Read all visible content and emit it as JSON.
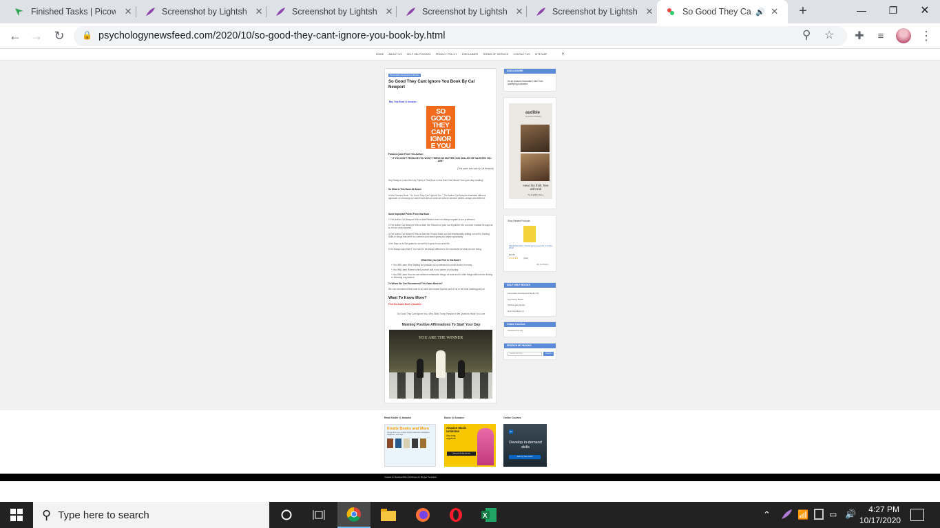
{
  "browser": {
    "tabs": [
      {
        "title": "Finished Tasks | Picowo",
        "icon": "picoworkers-arrow-icon",
        "active": false
      },
      {
        "title": "Screenshot by Lightshot",
        "icon": "lightshot-feather-icon",
        "active": false
      },
      {
        "title": "Screenshot by Lightshot",
        "icon": "lightshot-feather-icon",
        "active": false
      },
      {
        "title": "Screenshot by Lightshot",
        "icon": "lightshot-feather-icon",
        "active": false
      },
      {
        "title": "Screenshot by Lightshot",
        "icon": "lightshot-feather-icon",
        "active": false
      },
      {
        "title": "So Good They Cant",
        "icon": "site-favicon-icon",
        "active": true
      }
    ],
    "url": "psychologynewsfeed.com/2020/10/so-good-they-cant-ignore-you-book-by.html"
  },
  "site": {
    "nav": [
      "HOME",
      "ABOUT US",
      "SELF HELP BOOKS",
      "PRIVACY POLICY",
      "DISCLAIMER",
      "TERMS OF SERVICE",
      "CONTACT US",
      "SITE MAP"
    ],
    "post": {
      "category": "Personality Development Books",
      "title": "So Good They Cant Ignore You Book By Cal Newport",
      "buy_link": "Buy This Book @ Amazon :",
      "book_cover_text": "SO GOOD THEY CAN'T IGNORE YOU",
      "book_author": "CAL NEWPORT",
      "quote_heading": "Famous Quote From This Author :",
      "quote": "\" IF YOU DON'T PRODUCE YOU WON'T THRIVE-NO MATTER HOW SKILLED OR TALENTED YOU ARE.\"",
      "quote_attr": "(This quote was said by Cal Newport)",
      "intro": "Hey Ready to Learn the Key Points of This Book in less than One Minute? then just keep reading!",
      "about_heading": "So What Is This Book All About :",
      "about_text": "In this Famous Book \" So Good They Can't Ignore You \", The Author Cal Newport Illustrates different approach on choosing our career and tells us what we need to become skilled, unique and different.",
      "points_heading": "Some Important Points From this Book :",
      "points": [
        "1.The Author Cal Newport Tells us that Passion does not always equate to our profession.",
        "2.The Author Cal Newport Tells us that, We Should not pour our impulsive into our work, Instead he says us to, let our work impress.",
        "3.The Author Cal Newport Tells us that We Should Make our self irreplaceably skilling our self in Gaining Skills in things that aren't so common and which gives you ample opportunity.",
        "4.He Says us to Set goals for our self is to grow in our work life.",
        "5.He Always says that if, You have to be always different to be successful at what you are doing."
      ],
      "learn_heading": "What Else you Can Find in this Book?",
      "learn_items": [
        "+ You Will Learn Why Settling our passion as a profession is a bad choice for many.",
        "+ You Will Learn Where to find yourself skill in our career of choosing.",
        "+ You Will Learn How we can achieve remarkable things, at work and in other things without ever finding or following our passion."
      ],
      "recommend_heading": "To Whom We Can Recommend This Game Book to?",
      "recommend_text": "We can recommend this book to an adult who doesn't spend part of his or her time creating just yet.",
      "want_more": "Want To Know More?",
      "audio_link": "Find this Audio Book @Audible :",
      "audio_caption": "So Good They Cant Ignore You: Why Skills Trump Passion in the Quest for Work You Love",
      "video_title": "Morning Positive Affirmations To Start Your Day",
      "video_overlay": "YOU ARE THE WINNER"
    },
    "sidebar": {
      "disclosure_head": "DISCLOSURE",
      "disclosure_text": "As an Amazon Associate I earn from qualifying purchases.",
      "audible_brand": "audible",
      "audible_sub": "an amazon company",
      "audible_tagline": "Hear the thrill, free with trial",
      "audible_cta": "Try Audible Free ›",
      "shop_head": "Shop Related Products",
      "product_title": "Digital Minimalism: Choosing a Focused Life in a Noisy World",
      "product_price": "$14.30",
      "product_rating": "(1891)",
      "ads_label": "Ads by Amazon",
      "selfhelp_head": "SELF HELP BOOKS",
      "selfhelp_items": [
        "Personality Development Books (16)",
        "Psychology Books",
        "Spiritual Help Books",
        "Most Sold Book (1)"
      ],
      "online_head": "Online Courses",
      "online_items": [
        "Coursera (for out)"
      ],
      "search_head": "SEARCH MY BOOKS",
      "search_placeholder": "Search this blog",
      "search_btn": "Search"
    },
    "footer": {
      "cols": [
        {
          "title": "Read Kindle @ Amazon",
          "ad_title": "Kindle Books and More",
          "ad_text": "Choose from over 1 million Kindle books plus newspapers, magazines, and blogs."
        },
        {
          "title": "Music @ Amazon",
          "ad_title": "Amazon Music Unlimited",
          "ad_text": "Any song, anywhere",
          "ad_cta": "Start your 30-day free trial"
        },
        {
          "title": "Online Courses",
          "ad_title": "Develop in-demand skills",
          "ad_cta": "Start my free month"
        }
      ],
      "credit": "Created by NewsFeedSite | Distributed by Blogger Templates"
    }
  },
  "taskbar": {
    "search_placeholder": "Type here to search",
    "time": "4:27 PM",
    "date": "10/17/2020"
  }
}
